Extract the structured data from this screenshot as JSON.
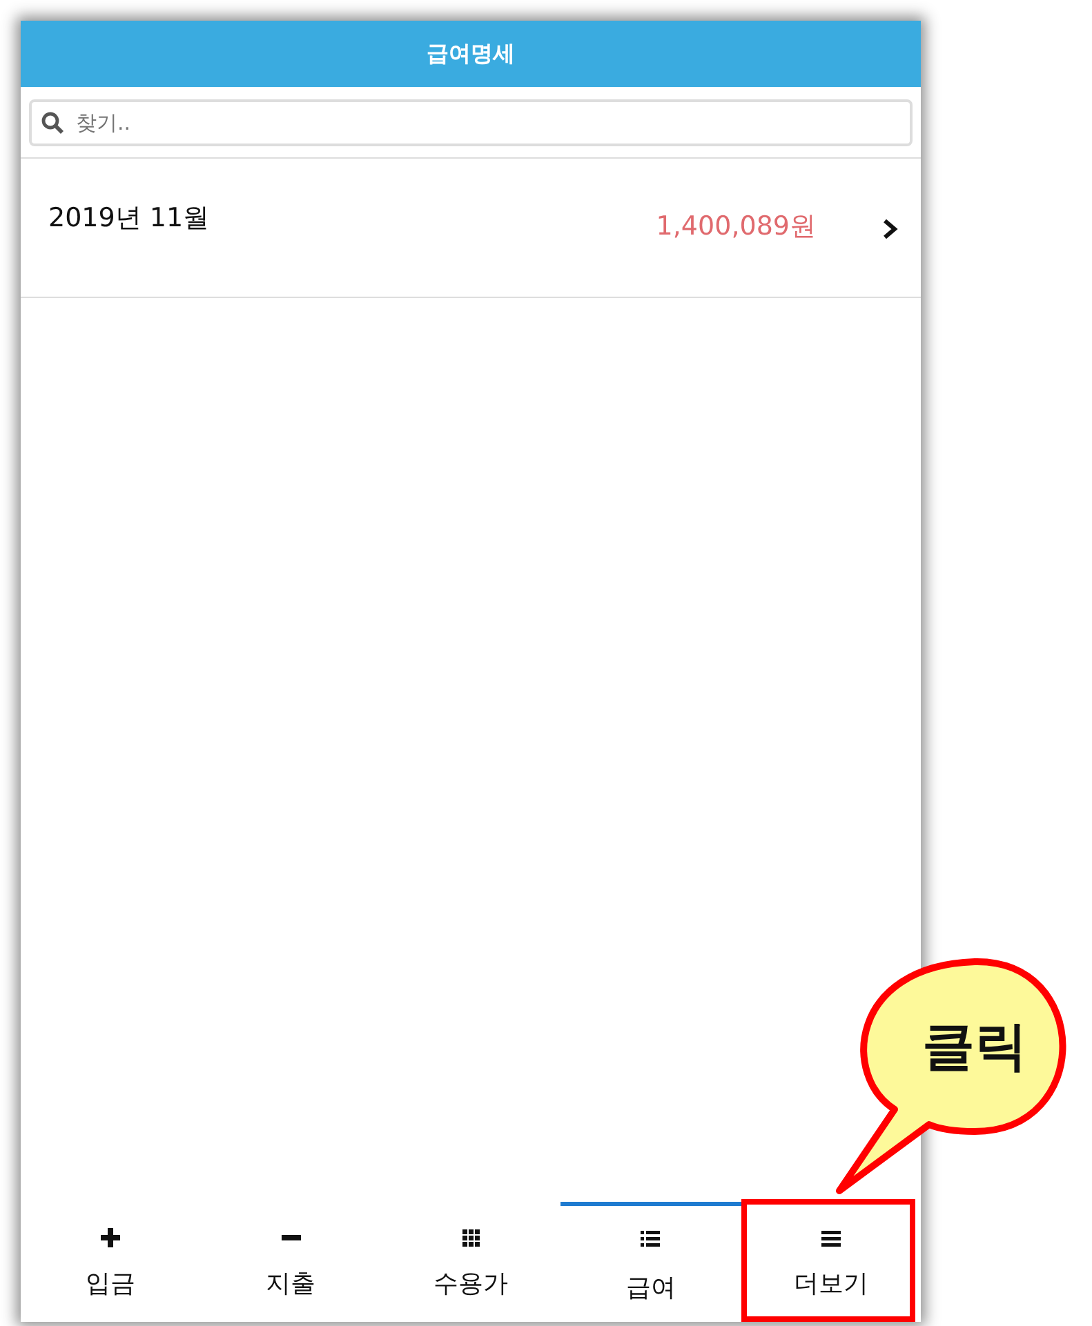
{
  "header": {
    "title": "급여명세"
  },
  "search": {
    "placeholder": "찾기.."
  },
  "rows": [
    {
      "label": "2019년 11월",
      "amount": "1,400,089원"
    }
  ],
  "tabs": [
    {
      "label": "입금",
      "kind": "plus",
      "selected": false,
      "highlighted": false
    },
    {
      "label": "지출",
      "kind": "minus",
      "selected": false,
      "highlighted": false
    },
    {
      "label": "수용가",
      "kind": "grid",
      "selected": false,
      "highlighted": false
    },
    {
      "label": "급여",
      "kind": "list",
      "selected": true,
      "highlighted": false
    },
    {
      "label": "더보기",
      "kind": "bars",
      "selected": false,
      "highlighted": true
    }
  ],
  "callout": {
    "text": "클릭"
  }
}
